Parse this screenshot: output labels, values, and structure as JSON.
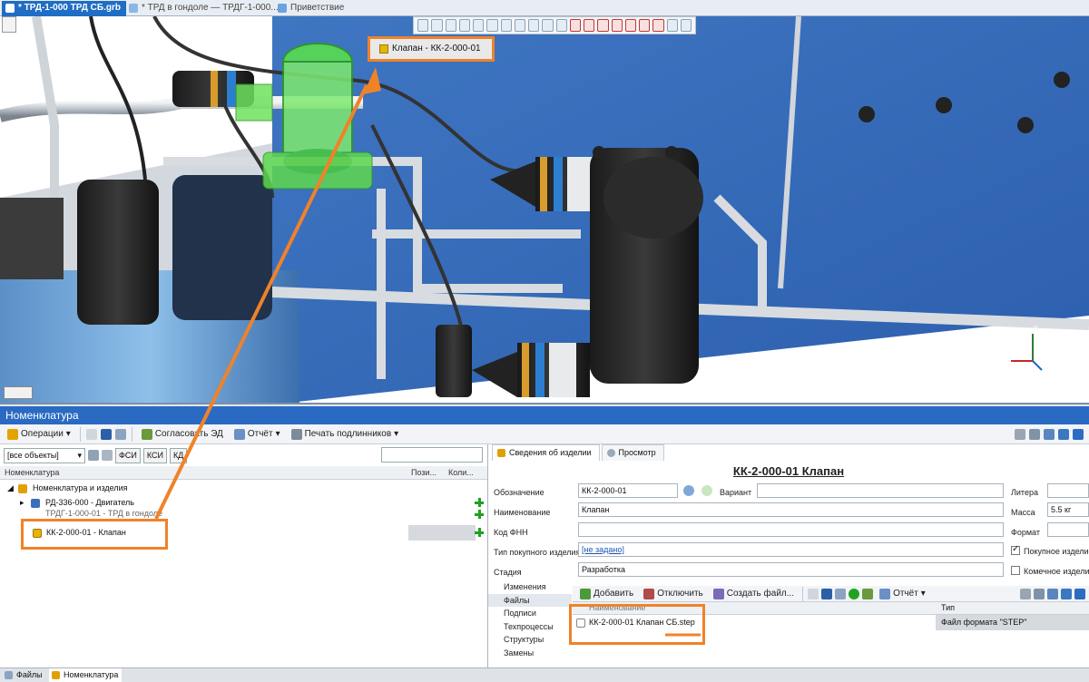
{
  "tabs": [
    {
      "label": "* ТРД-1-000 ТРД СБ.grb",
      "active": true
    },
    {
      "label": "* ТРД в гондоле — ТРДГ-1-000...",
      "active": false
    },
    {
      "label": "Приветствие",
      "active": false
    }
  ],
  "viewport": {
    "hover_label": "Клапан - КК-2-000-01",
    "axes": {
      "z": "Z",
      "x": "X"
    }
  },
  "nomenclature": {
    "title": "Номенклатура",
    "toolbar": {
      "operations": "Операции",
      "approve": "Согласовать ЭД",
      "report": "Отчёт",
      "print": "Печать подлинников"
    },
    "filter": {
      "value": "[все объекты]",
      "buttons": [
        "ФСИ",
        "КСИ",
        "КД"
      ]
    },
    "columns": [
      "Номенклатура",
      "Пози...",
      "Коли..."
    ],
    "tree": [
      {
        "label": "Номенклатура и изделия",
        "level": 0
      },
      {
        "label": "РД-336-000 - Двигатель",
        "level": 1
      },
      {
        "label": "ТРДГ-1-000-01 - ТРД в гондоле",
        "level": 1
      },
      {
        "label": "КК-2-000-01 -  Клапан",
        "level": 1,
        "selected": true
      }
    ]
  },
  "details": {
    "tabs": [
      "Сведения об изделии",
      "Просмотр"
    ],
    "title": "КК-2-000-01  Клапан",
    "fields": {
      "designation_label": "Обозначение",
      "designation_value": "КК-2-000-01",
      "variant_label": "Вариант",
      "name_label": "Наименование",
      "name_value": "Клапан",
      "fnn_label": "Код ФНН",
      "purchase_type_label": "Тип покупного изделия",
      "purchase_type_value": "[не задано]",
      "stage_label": "Стадия",
      "stage_value": "Разработка",
      "litera_label": "Литера",
      "mass_label": "Масса",
      "mass_value": "5.5 кг",
      "format_label": "Формат",
      "purchased_label": "Покупное изделие",
      "purchased_checked": true,
      "cable_label": "Комечное изделие",
      "cable_checked": false
    },
    "side_list": [
      "Изменения",
      "Файлы",
      "Подписи",
      "Техпроцессы",
      "Структуры",
      "Замены"
    ],
    "files_toolbar": {
      "add": "Добавить",
      "detach": "Отключить",
      "create": "Создать файл...",
      "report": "Отчёт"
    },
    "files_columns": [
      "Наименование",
      "Тип"
    ],
    "files": [
      {
        "name": "КК-2-000-01 Клапан СБ.step",
        "type": "Файл формата \"STEP\""
      }
    ]
  },
  "statusbar": {
    "tabs": [
      "Файлы",
      "Номенклатура"
    ]
  },
  "colors": {
    "accent": "#1f6dc4",
    "highlight": "#f0822a",
    "selection": "#5be34a"
  }
}
